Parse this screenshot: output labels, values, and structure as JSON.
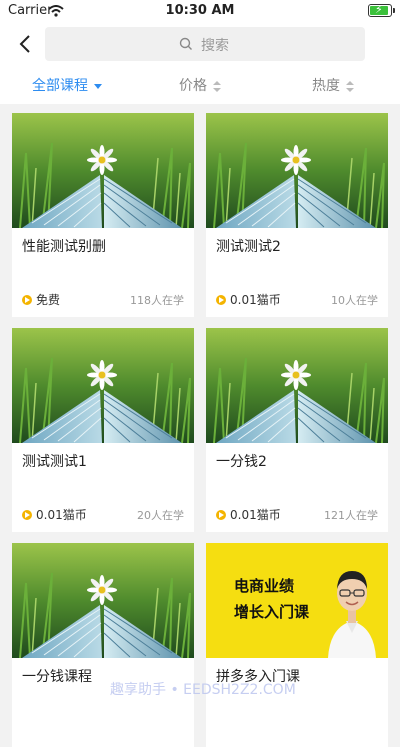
{
  "statusbar": {
    "carrier": "Carrier",
    "time": "10:30 AM",
    "battery_level": 0.9
  },
  "search": {
    "placeholder": "搜索"
  },
  "filters": {
    "all_courses": "全部课程",
    "price": "价格",
    "popularity": "热度"
  },
  "courses": [
    {
      "title": "性能测试别删",
      "price": "免费",
      "learners": "118人在学"
    },
    {
      "title": "测试测试2",
      "price": "0.01猫币",
      "learners": "10人在学"
    },
    {
      "title": "测试测试1",
      "price": "0.01猫币",
      "learners": "20人在学"
    },
    {
      "title": "一分钱2",
      "price": "0.01猫币",
      "learners": "121人在学"
    },
    {
      "title": "一分钱课程"
    },
    {
      "title": "拼多多入门课",
      "promo_line1": "电商业绩",
      "promo_line2": "增长入门课"
    }
  ],
  "watermark": "趣享助手 • EEDSH2Z2.COM",
  "colors": {
    "accent": "#2d8cf0",
    "coin": "#f4b400",
    "promo_bg": "#f5de11"
  }
}
